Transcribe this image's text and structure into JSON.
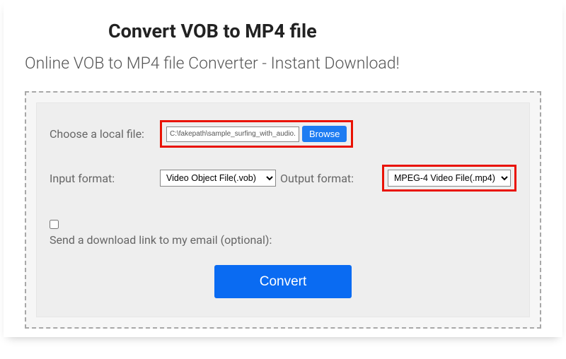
{
  "title": "Convert VOB to MP4 file",
  "subtitle": "Online VOB to MP4 file Converter - Instant Download!",
  "file": {
    "label": "Choose a local file:",
    "path": "C:\\fakepath\\sample_surfing_with_audio.vc",
    "browse": "Browse"
  },
  "input_format": {
    "label": "Input format:",
    "selected": "Video Object File(.vob)"
  },
  "output_format": {
    "label": "Output format:",
    "selected": "MPEG-4 Video File(.mp4)"
  },
  "email": {
    "label": "Send a download link to my email (optional):"
  },
  "convert": "Convert"
}
